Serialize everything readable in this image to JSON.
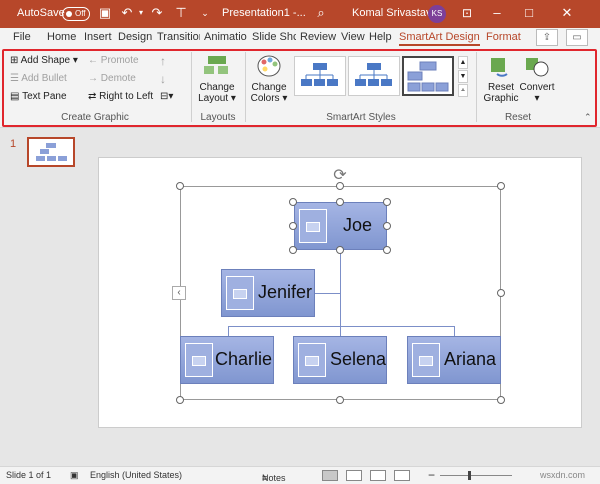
{
  "titlebar": {
    "autosave_label": "AutoSave",
    "autosave_state": "Off",
    "doc_title": "Presentation1 -...",
    "user_name": "Komal Srivastava",
    "user_initials": "KS"
  },
  "tabs": [
    "File",
    "Home",
    "Insert",
    "Design",
    "Transition",
    "Animatio",
    "Slide Shc",
    "Review",
    "View",
    "Help",
    "SmartArt Design",
    "Format"
  ],
  "ribbon": {
    "add_shape": "Add Shape",
    "add_bullet": "Add Bullet",
    "text_pane": "Text Pane",
    "promote": "Promote",
    "demote": "Demote",
    "right_to_left": "Right to Left",
    "change_layout_1": "Change",
    "change_layout_2": "Layout",
    "change_colors_1": "Change",
    "change_colors_2": "Colors",
    "reset_graphic_1": "Reset",
    "reset_graphic_2": "Graphic",
    "convert": "Convert",
    "groups": {
      "create_graphic": "Create Graphic",
      "layouts": "Layouts",
      "smartart_styles": "SmartArt Styles",
      "reset": "Reset"
    }
  },
  "slide_panel": {
    "number": "1"
  },
  "smartart": {
    "nodes": [
      "Joe",
      "Jenifer",
      "Charlie",
      "Selena",
      "Ariana"
    ]
  },
  "status": {
    "slide_info": "Slide 1 of 1",
    "language": "English (United States)",
    "notes": "Notes",
    "watermark": "wsxdn.com"
  },
  "colors": {
    "accent": "#b7472a",
    "node": "#8ba0d8",
    "highlight": "#e0262d"
  }
}
